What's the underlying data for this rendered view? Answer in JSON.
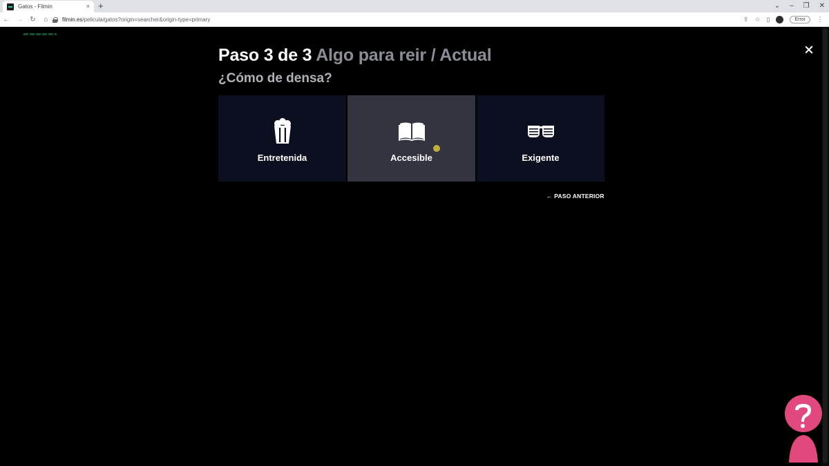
{
  "browser": {
    "tab": {
      "title": "Gatos - Filmin",
      "close": "×"
    },
    "new_tab": "+",
    "window": {
      "chevron": "⌄",
      "minimize": "–",
      "restore": "❐",
      "close": "✕"
    },
    "nav": {
      "back": "←",
      "forward": "→",
      "reload": "↻",
      "home": "⌂"
    },
    "url": {
      "host": "filmin.es",
      "path": "/pelicula/gatos?origin=searcher&origin-type=primary"
    },
    "toolbar": {
      "share": "⇪",
      "bookmark": "☆",
      "sidepanel": "▯",
      "error_label": "Error",
      "menu": "⋮"
    }
  },
  "wizard": {
    "step_label": "Paso 3 de 3",
    "step_path": "Algo para reir / Actual",
    "question": "¿Cómo de densa?",
    "options": [
      {
        "label": "Entretenida",
        "icon": "popcorn-icon"
      },
      {
        "label": "Accesible",
        "icon": "open-book-icon"
      },
      {
        "label": "Exigente",
        "icon": "shutter-glasses-icon"
      }
    ],
    "hovered_option": "Accesible",
    "previous_step": "← PASO ANTERIOR"
  },
  "colors": {
    "page_background": "#000000",
    "option_background": "#0c0f20",
    "option_hover": "#33343f",
    "heading_white": "#ffffff",
    "heading_muted": "#8b8e97",
    "watermark": "#e1497e"
  }
}
